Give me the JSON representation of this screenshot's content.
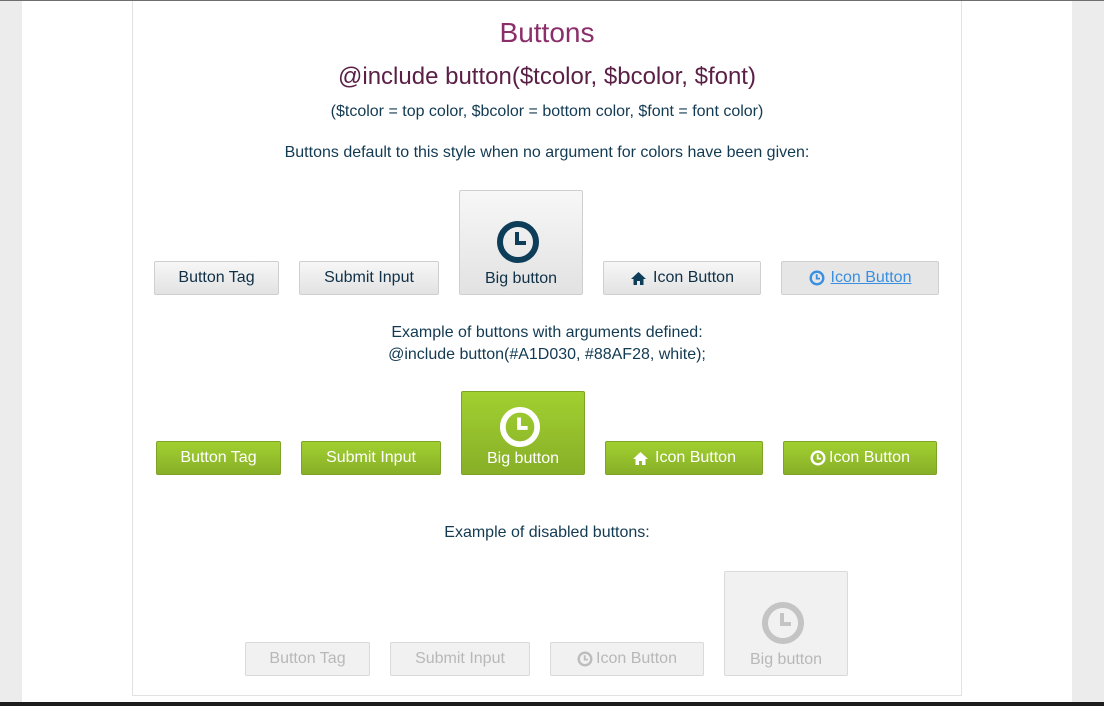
{
  "headings": {
    "title": "Buttons",
    "mixin": "@include button($tcolor, $bcolor, $font)",
    "params": "($tcolor = top color, $bcolor = bottom color, $font = font color)"
  },
  "sections": {
    "default_note": "Buttons default to this style when no argument for colors have been given:",
    "args_note_line1": "Example of buttons with arguments defined:",
    "args_note_line2": "@include button(#A1D030, #88AF28, white);",
    "disabled_note": "Example of disabled buttons:"
  },
  "default_buttons": {
    "button_tag": "Button Tag",
    "submit_input": "Submit Input",
    "big_button": "Big button",
    "home_icon_button": "Icon Button",
    "clock_icon_button": "Icon Button"
  },
  "green_buttons": {
    "button_tag": "Button Tag",
    "submit_input": "Submit Input",
    "big_button": "Big button",
    "home_icon_button": "Icon Button",
    "clock_icon_button": "Icon Button"
  },
  "disabled_buttons": {
    "button_tag": "Button Tag",
    "submit_input": "Submit Input",
    "clock_icon_button": "Icon Button",
    "big_button": "Big button"
  },
  "icons": {
    "clock": "clock-icon",
    "home": "home-icon"
  },
  "colors": {
    "title": "#8a2f6a",
    "text": "#123a52",
    "green_top": "#A1D030",
    "green_bottom": "#88AF28",
    "link": "#3a8fe0"
  }
}
